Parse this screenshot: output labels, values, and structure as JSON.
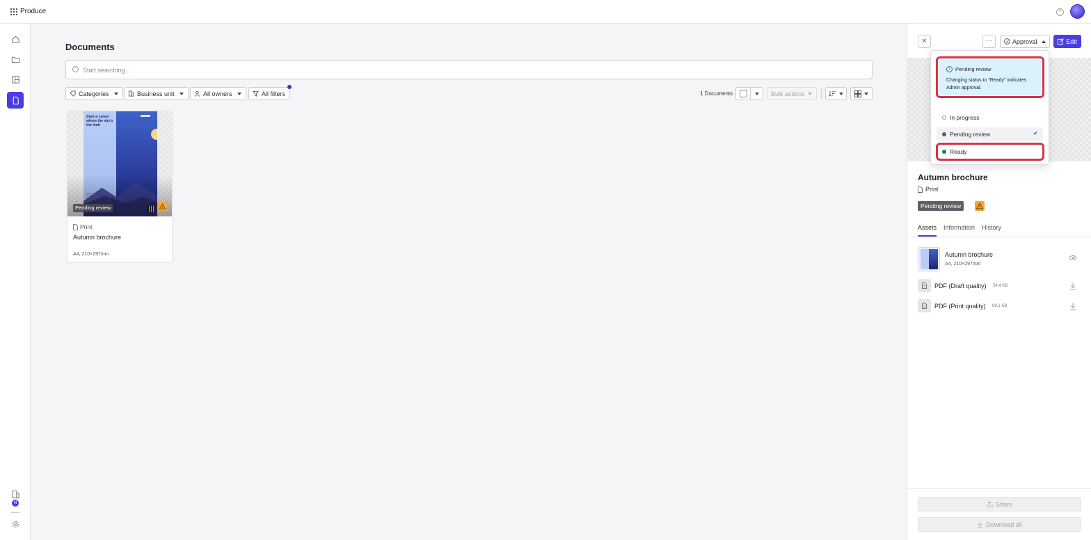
{
  "app": {
    "name": "Produce"
  },
  "main": {
    "title": "Documents",
    "search_placeholder": "Start searching...",
    "filters": [
      "Categories",
      "Business unit",
      "All owners",
      "All filters"
    ],
    "doc_count": "1 Documents",
    "bulk_actions": "Bulk actions"
  },
  "card": {
    "status": "Pending review",
    "type": "Print",
    "name": "Autumn brochure",
    "size": "A4, 210×297mm",
    "poster_headline": "Start a career where the sky's the limit"
  },
  "panel": {
    "approval_label": "Approval",
    "edit_label": "Edit",
    "title": "Autumn brochure",
    "type": "Print",
    "status": "Pending review",
    "tabs": [
      "Assets",
      "Information",
      "History"
    ],
    "asset": {
      "name": "Autumn brochure",
      "size": "A4, 210×297mm"
    },
    "files": [
      {
        "name": "PDF (Draft quality)",
        "size": "54.4 KB"
      },
      {
        "name": "PDF (Print quality)",
        "size": "69.1 KB"
      }
    ],
    "share_label": "Share",
    "download_label": "Download all"
  },
  "dropdown": {
    "info_title": "Pending review",
    "info_text": "Changing status to \"Ready\" indicates Admin approval.",
    "options": [
      {
        "label": "In progress",
        "color": "#ffffff"
      },
      {
        "label": "Pending review",
        "color": "#5e6066"
      },
      {
        "label": "Ready",
        "color": "#2e7d4f"
      }
    ]
  },
  "colors": {
    "accent": "#4b3ee0",
    "highlight": "#d63447",
    "warning": "#f2a93b"
  }
}
